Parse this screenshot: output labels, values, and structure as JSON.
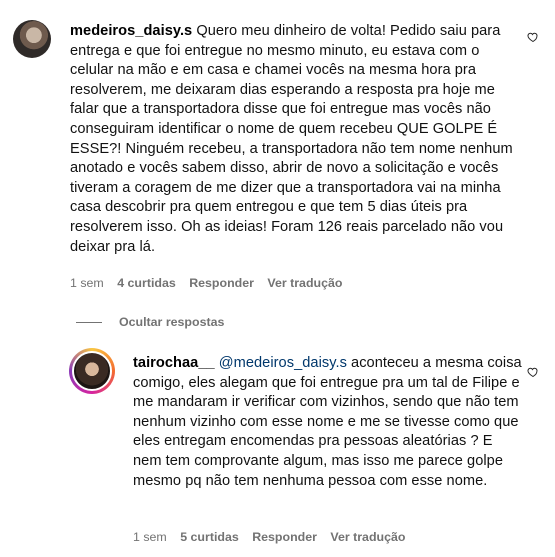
{
  "comments": [
    {
      "username": "medeiros_daisy.s",
      "text": "Quero meu dinheiro de volta! Pedido saiu para entrega e que foi entregue no mesmo minuto, eu estava com o celular na mão e em casa e chamei vocês na mesma hora pra resolverem, me deixaram dias esperando a resposta pra hoje me falar que a transportadora disse que foi entregue mas vocês não conseguiram identificar o nome de quem recebeu QUE GOLPE É ESSE?! Ninguém recebeu, a transportadora não tem nome nenhum anotado e vocês sabem disso, abrir de novo a solicitação e vocês tiveram a coragem de me dizer que a transportadora vai na minha casa descobrir pra quem entregou e que tem 5 dias úteis pra resolverem isso. Oh as ideias! Foram 126 reais parcelado não vou deixar pra lá.",
      "time": "1 sem",
      "likes": "4 curtidas",
      "reply_label": "Responder",
      "translate_label": "Ver tradução"
    },
    {
      "username": "tairochaa__",
      "mention": "@medeiros_daisy.s",
      "text": "aconteceu a mesma coisa comigo, eles alegam que foi entregue pra um tal de Filipe e me mandaram ir verificar com vizinhos, sendo que não tem nenhum vizinho com esse nome e me se tivesse como que eles entregam encomendas pra pessoas aleatórias ? E nem tem comprovante algum, mas isso me parece golpe mesmo pq não tem nenhuma pessoa com esse nome.",
      "time": "1 sem",
      "likes": "5 curtidas",
      "reply_label": "Responder",
      "translate_label": "Ver tradução"
    }
  ],
  "hide_replies_label": "Ocultar respostas",
  "icons": {
    "like": "heart-outline-icon"
  },
  "colors": {
    "meta": "#737373",
    "mention": "#00376b"
  }
}
